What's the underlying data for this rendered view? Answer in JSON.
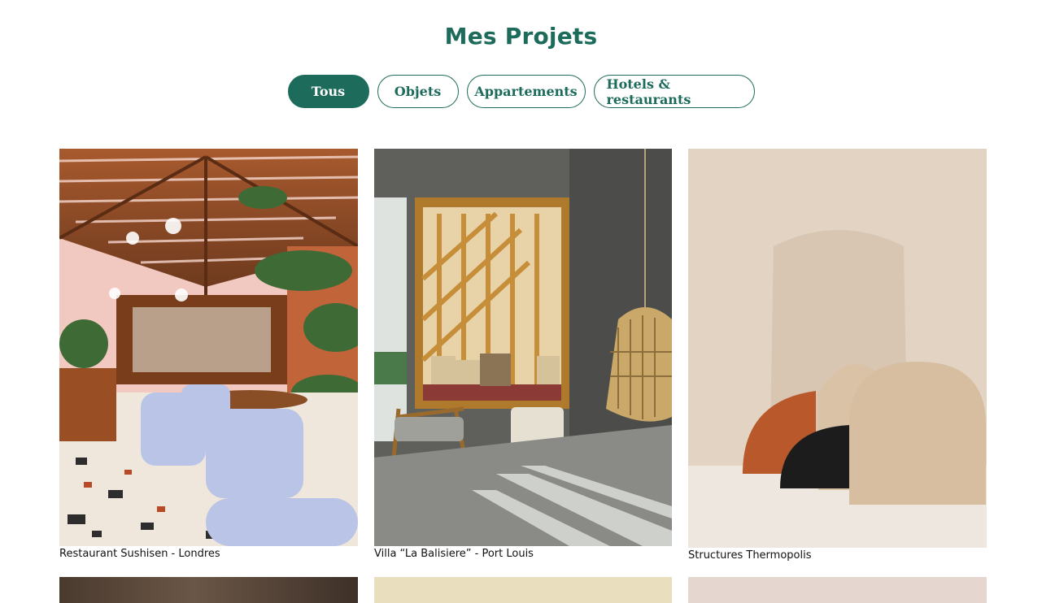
{
  "page": {
    "title": "Mes Projets"
  },
  "filters": [
    {
      "label": "Tous",
      "active": true
    },
    {
      "label": "Objets",
      "active": false
    },
    {
      "label": "Appartements",
      "active": false
    },
    {
      "label": "Hotels & restaurants",
      "active": false
    }
  ],
  "projects": [
    {
      "caption": "Restaurant Sushisen - Londres"
    },
    {
      "caption": "Villa “La Balisiere” - Port Louis"
    },
    {
      "caption": "Structures Thermopolis"
    }
  ],
  "colors": {
    "accent": "#1d6b5a",
    "background": "#ffffff"
  }
}
